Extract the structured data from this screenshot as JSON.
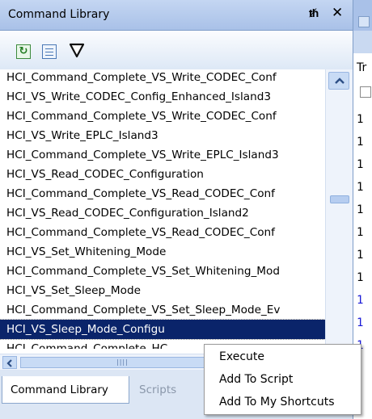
{
  "panel": {
    "title": "Command Library",
    "pin_glyph": "p",
    "close_glyph": "×"
  },
  "toolbar": {
    "refresh_icon": "refresh-icon",
    "list_icon": "list-icon",
    "filter_icon": "filter-icon"
  },
  "commands": [
    "HCI_Command_Complete_VS_Write_CODEC_Conf",
    "HCI_VS_Write_CODEC_Config_Enhanced_Island3",
    "HCI_Command_Complete_VS_Write_CODEC_Conf",
    "HCI_VS_Write_EPLC_Island3",
    "HCI_Command_Complete_VS_Write_EPLC_Island3",
    "HCI_VS_Read_CODEC_Configuration",
    "HCI_Command_Complete_VS_Read_CODEC_Conf",
    "HCI_VS_Read_CODEC_Configuration_Island2",
    "HCI_Command_Complete_VS_Read_CODEC_Conf",
    "HCI_VS_Set_Whitening_Mode",
    "HCI_Command_Complete_VS_Set_Whitening_Mod",
    "HCI_VS_Set_Sleep_Mode",
    "HCI_Command_Complete_VS_Set_Sleep_Mode_Ev",
    "HCI_VS_Sleep_Mode_Configu",
    "HCI_Command_Complete_HC"
  ],
  "selected_index": 13,
  "tabs": {
    "active": "Command Library",
    "inactive": "Scripts"
  },
  "right_panel": {
    "header": "Tr",
    "line_numbers": [
      "1",
      "1",
      "1",
      "1",
      "1",
      "1",
      "1",
      "1",
      "1",
      "1",
      "1"
    ],
    "number_colors": [
      "#000000",
      "#000000",
      "#000000",
      "#000000",
      "#000000",
      "#000000",
      "#000000",
      "#000000",
      "#1a1ad6",
      "#1a1ad6",
      "#1a1ad6"
    ]
  },
  "context_menu": {
    "items": [
      "Execute",
      "Add To Script",
      "Add To My Shortcuts"
    ]
  },
  "colors": {
    "title_bar": "#a9c1e8",
    "selection": "#0a246a"
  }
}
